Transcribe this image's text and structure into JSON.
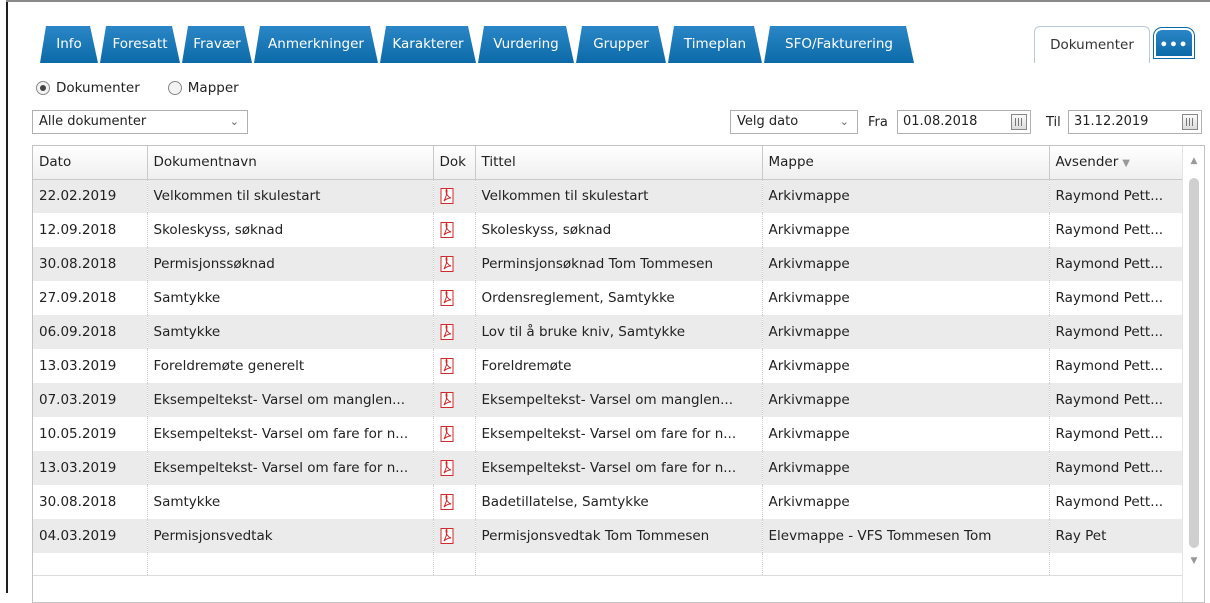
{
  "tabs": [
    {
      "label": "Info"
    },
    {
      "label": "Foresatt"
    },
    {
      "label": "Fravær"
    },
    {
      "label": "Anmerkninger"
    },
    {
      "label": "Karakterer"
    },
    {
      "label": "Vurdering"
    },
    {
      "label": "Grupper"
    },
    {
      "label": "Timeplan"
    },
    {
      "label": "SFO/Fakturering"
    },
    {
      "label": "Dokumenter",
      "active": true
    },
    {
      "label": "•••"
    }
  ],
  "view_mode": {
    "options": [
      {
        "label": "Dokumenter",
        "checked": true
      },
      {
        "label": "Mapper",
        "checked": false
      }
    ]
  },
  "filters": {
    "document_type": "Alle dokumenter",
    "date_select": "Velg dato",
    "from_label": "Fra",
    "from_date": "01.08.2018",
    "to_label": "Til",
    "to_date": "31.12.2019"
  },
  "grid": {
    "columns": {
      "date": "Dato",
      "name": "Dokumentnavn",
      "doc": "Dok",
      "title": "Tittel",
      "folder": "Mappe",
      "sender": "Avsender"
    },
    "sort_column": "sender",
    "rows": [
      {
        "date": "22.02.2019",
        "name": "Velkommen til skulestart",
        "title": "Velkommen til skulestart",
        "folder": "Arkivmappe",
        "sender": "Raymond Pett..."
      },
      {
        "date": "12.09.2018",
        "name": "Skoleskyss, søknad",
        "title": "Skoleskyss, søknad",
        "folder": "Arkivmappe",
        "sender": "Raymond Pett..."
      },
      {
        "date": "30.08.2018",
        "name": "Permisjonssøknad",
        "title": "Perminsjonsøknad Tom Tommesen",
        "folder": "Arkivmappe",
        "sender": "Raymond Pett..."
      },
      {
        "date": "27.09.2018",
        "name": "Samtykke",
        "title": "Ordensreglement, Samtykke",
        "folder": "Arkivmappe",
        "sender": "Raymond Pett..."
      },
      {
        "date": "06.09.2018",
        "name": "Samtykke",
        "title": "Lov til å bruke kniv, Samtykke",
        "folder": "Arkivmappe",
        "sender": "Raymond Pett..."
      },
      {
        "date": "13.03.2019",
        "name": "Foreldremøte generelt",
        "title": "Foreldremøte",
        "folder": "Arkivmappe",
        "sender": "Raymond Pett..."
      },
      {
        "date": "07.03.2019",
        "name": "Eksempeltekst- Varsel om manglen...",
        "title": "Eksempeltekst- Varsel om manglen...",
        "folder": "Arkivmappe",
        "sender": "Raymond Pett..."
      },
      {
        "date": "10.05.2019",
        "name": "Eksempeltekst- Varsel om fare for n...",
        "title": "Eksempeltekst- Varsel om fare for n...",
        "folder": "Arkivmappe",
        "sender": "Raymond Pett..."
      },
      {
        "date": "13.03.2019",
        "name": "Eksempeltekst- Varsel om fare for n...",
        "title": "Eksempeltekst- Varsel om fare for n...",
        "folder": "Arkivmappe",
        "sender": "Raymond Pett..."
      },
      {
        "date": "30.08.2018",
        "name": "Samtykke",
        "title": "Badetillatelse, Samtykke",
        "folder": "Arkivmappe",
        "sender": "Raymond Pett..."
      },
      {
        "date": "04.03.2019",
        "name": "Permisjonsvedtak",
        "title": "Permisjonsvedtak Tom Tommesen",
        "folder": "Elevmappe - VFS Tommesen Tom",
        "sender": "Ray Pet"
      }
    ]
  },
  "colors": {
    "tab_blue": "#0d6aa8",
    "pdf_red": "#d22a2a",
    "row_alt": "#ebebeb"
  },
  "icons": {
    "doc": "pdf-icon",
    "calendar": "calendar-icon",
    "dropdown": "chevron-down-icon"
  }
}
